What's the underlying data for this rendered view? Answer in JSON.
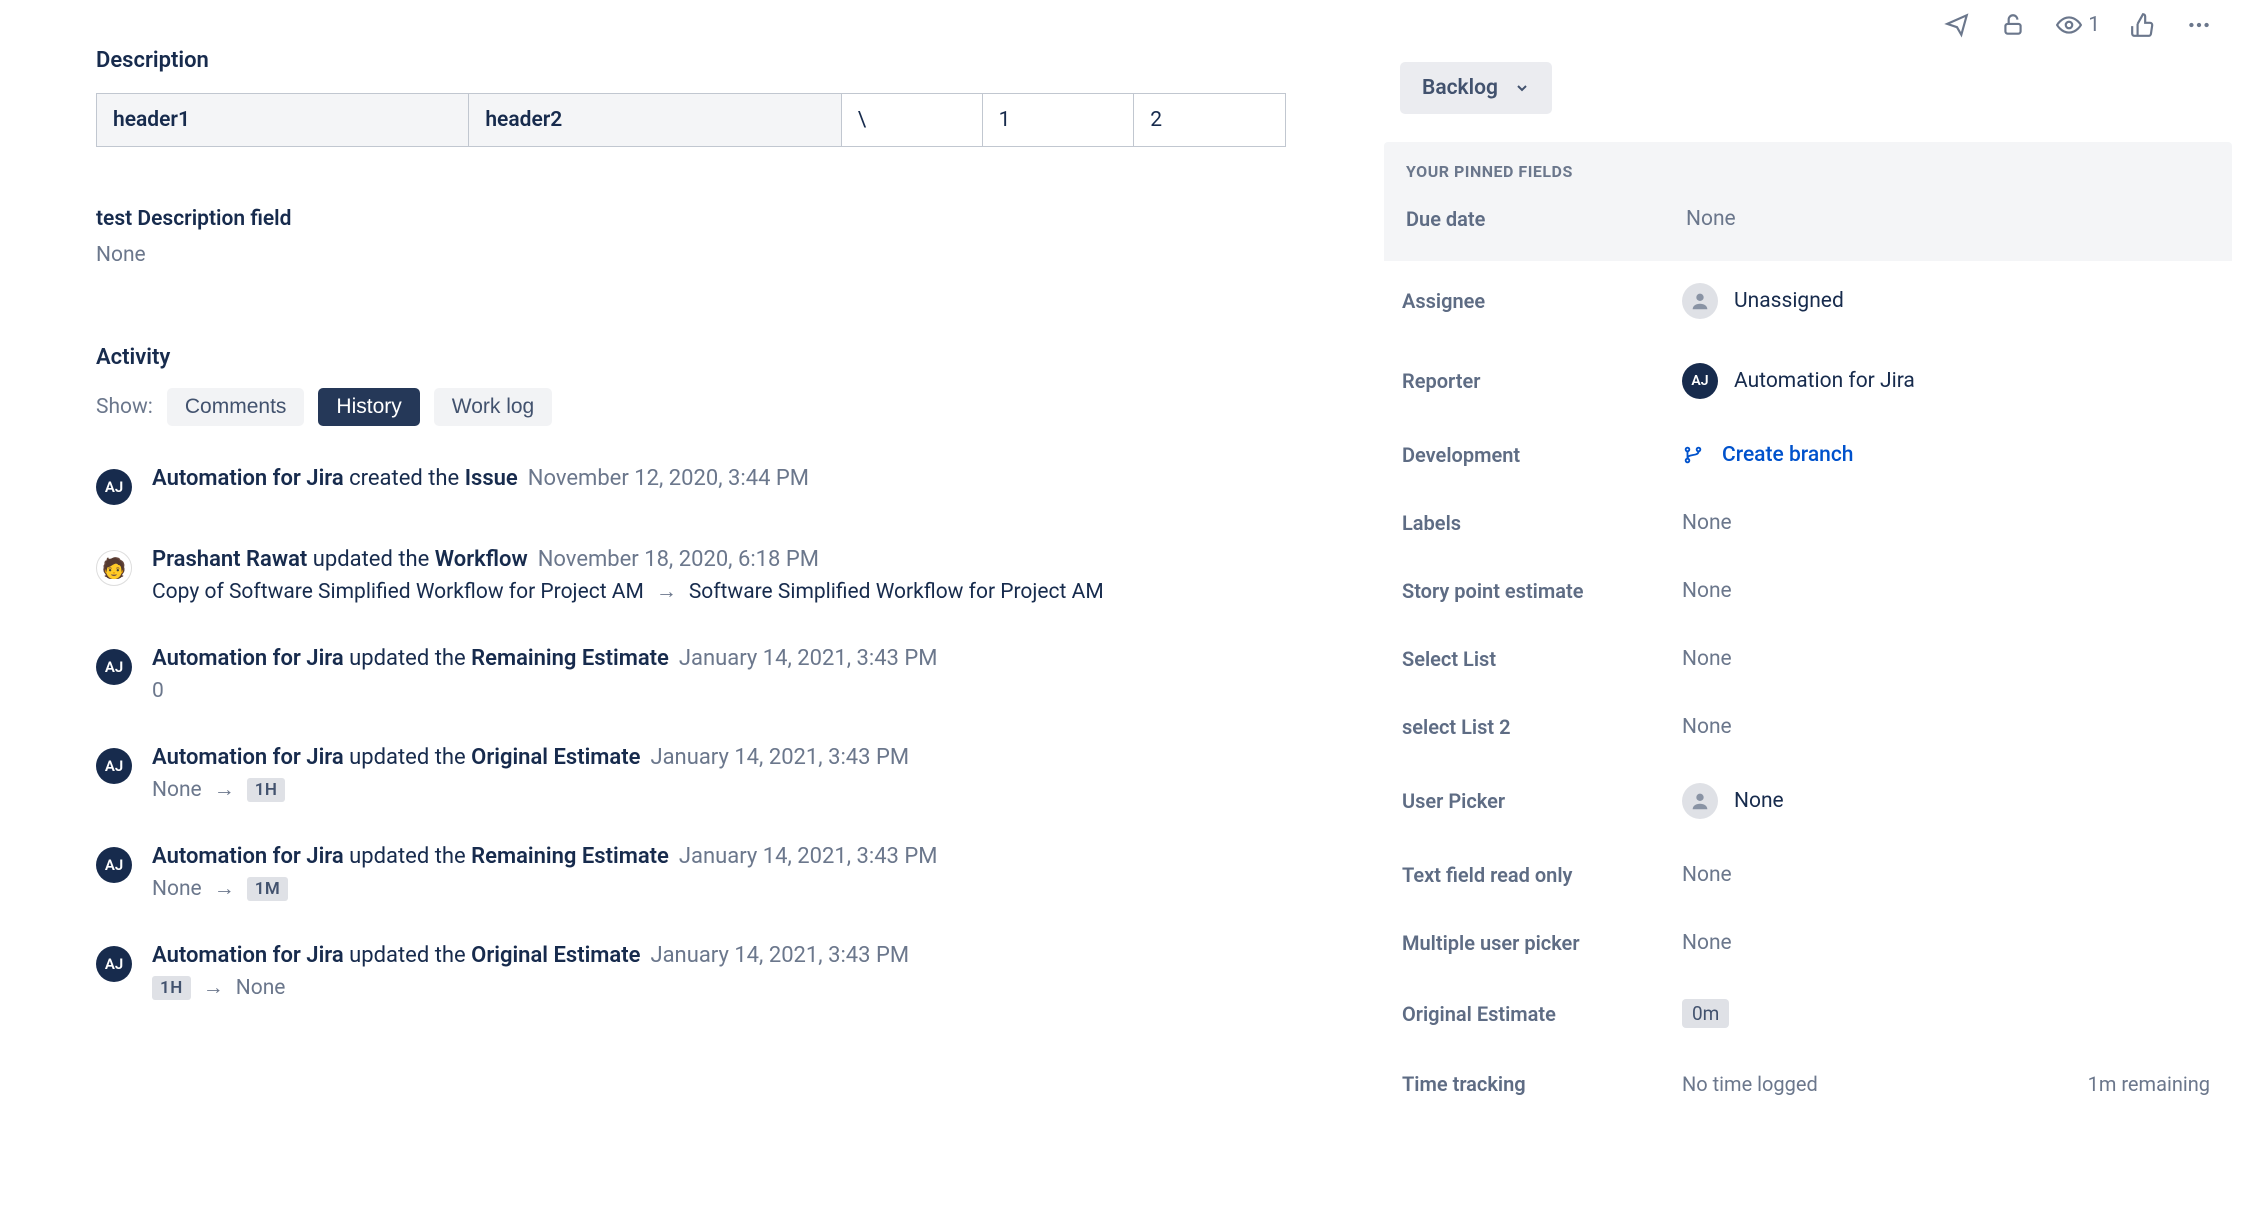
{
  "description": {
    "heading": "Description",
    "table": {
      "header1": "header1",
      "header2": "header2",
      "cell3": "\\",
      "cell4": "1",
      "cell5": "2"
    }
  },
  "customField": {
    "label": "test Description field",
    "value": "None"
  },
  "activity": {
    "heading": "Activity",
    "showLabel": "Show:",
    "tabs": {
      "comments": "Comments",
      "history": "History",
      "worklog": "Work log"
    }
  },
  "history": [
    {
      "avatar": "AJ",
      "avatarClass": "",
      "actor": "Automation for Jira",
      "verb": "created the",
      "field": "Issue",
      "ts": "November 12, 2020, 3:44 PM",
      "change": null
    },
    {
      "avatar": "🧑",
      "avatarClass": "prashant",
      "actor": "Prashant Rawat",
      "verb": "updated the",
      "field": "Workflow",
      "ts": "November 18, 2020, 6:18 PM",
      "change": {
        "type": "plain",
        "from": "Copy of Software Simplified Workflow for Project AM",
        "to": "Software Simplified Workflow for Project AM"
      }
    },
    {
      "avatar": "AJ",
      "avatarClass": "",
      "actor": "Automation for Jira",
      "verb": "updated the",
      "field": "Remaining Estimate",
      "ts": "January 14, 2021, 3:43 PM",
      "change": {
        "type": "text",
        "value": "0"
      }
    },
    {
      "avatar": "AJ",
      "avatarClass": "",
      "actor": "Automation for Jira",
      "verb": "updated the",
      "field": "Original Estimate",
      "ts": "January 14, 2021, 3:43 PM",
      "change": {
        "type": "chip",
        "from": "None",
        "to": "1H",
        "fromChip": false,
        "toChip": true
      }
    },
    {
      "avatar": "AJ",
      "avatarClass": "",
      "actor": "Automation for Jira",
      "verb": "updated the",
      "field": "Remaining Estimate",
      "ts": "January 14, 2021, 3:43 PM",
      "change": {
        "type": "chip",
        "from": "None",
        "to": "1M",
        "fromChip": false,
        "toChip": true
      }
    },
    {
      "avatar": "AJ",
      "avatarClass": "",
      "actor": "Automation for Jira",
      "verb": "updated the",
      "field": "Original Estimate",
      "ts": "January 14, 2021, 3:43 PM",
      "change": {
        "type": "chip",
        "from": "1H",
        "to": "None",
        "fromChip": true,
        "toChip": false
      }
    }
  ],
  "rightHeader": {
    "watchers": "1"
  },
  "status": {
    "label": "Backlog"
  },
  "pinned": {
    "title": "YOUR PINNED FIELDS",
    "dueDateLabel": "Due date",
    "dueDateValue": "None"
  },
  "fields": {
    "assignee": {
      "label": "Assignee",
      "value": "Unassigned"
    },
    "reporter": {
      "label": "Reporter",
      "value": "Automation for Jira",
      "avatar": "AJ"
    },
    "development": {
      "label": "Development",
      "value": "Create branch"
    },
    "labels": {
      "label": "Labels",
      "value": "None"
    },
    "storyPoint": {
      "label": "Story point estimate",
      "value": "None"
    },
    "selectList": {
      "label": "Select List",
      "value": "None"
    },
    "selectList2": {
      "label": "select List 2",
      "value": "None"
    },
    "userPicker": {
      "label": "User Picker",
      "value": "None"
    },
    "textReadOnly": {
      "label": "Text field read only",
      "value": "None"
    },
    "multiUserPicker": {
      "label": "Multiple user picker",
      "value": "None"
    },
    "originalEstimate": {
      "label": "Original Estimate",
      "value": "0m"
    },
    "timeTracking": {
      "label": "Time tracking",
      "logged": "No time logged",
      "remaining": "1m remaining"
    }
  }
}
